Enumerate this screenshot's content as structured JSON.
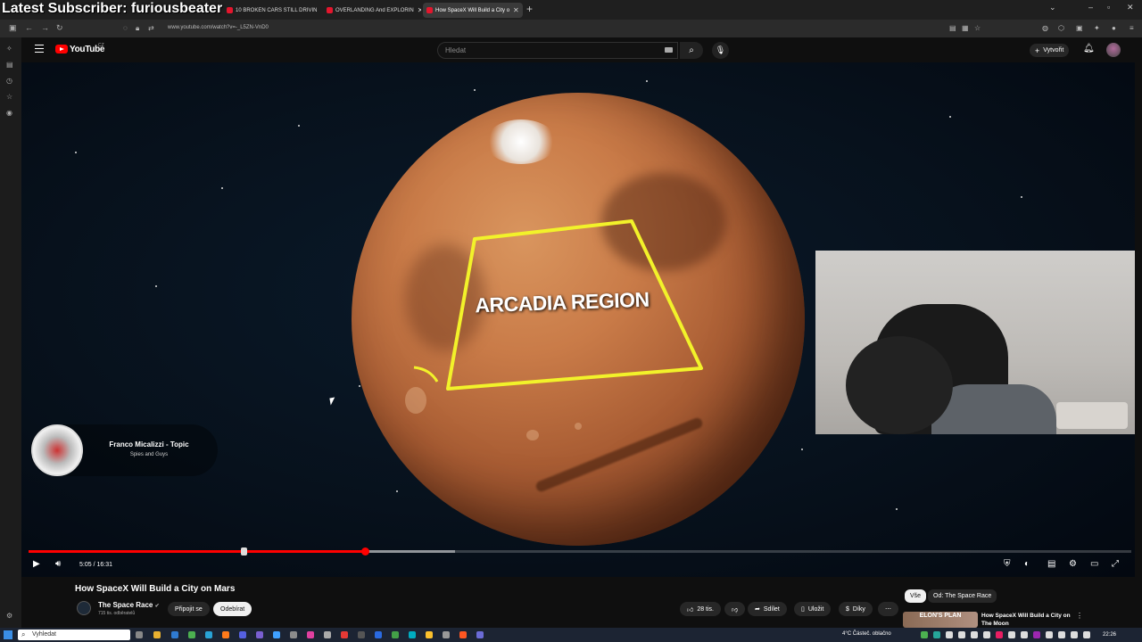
{
  "overlay_text": "Latest Subscriber: furiousbeater",
  "browser": {
    "tabs": [
      {
        "label": "10 BROKEN CARS STILL DRIVIN"
      },
      {
        "label": "OVERLANDING And EXPLORIN"
      },
      {
        "label": "How SpaceX Will Build a City o"
      }
    ],
    "url": "www.youtube.com/watch?v=-_L5ZN-VnD0"
  },
  "youtube": {
    "logo_text": "YouTube",
    "country_code": "CZ",
    "search_placeholder": "Hledat",
    "create_label": "Vytvořit"
  },
  "video": {
    "region_label": "ARCADIA REGION",
    "card": {
      "title": "Franco Micalizzi - Topic",
      "subtitle": "Spies and Guys"
    },
    "time": "5:05 / 16:31",
    "progress_played": 0.305,
    "progress_buffered": 0.387
  },
  "meta": {
    "title": "How SpaceX Will Build a City on Mars",
    "channel": "The Space Race",
    "subscribers": "715 tis. odběratelů",
    "join_label": "Připojit se",
    "subscribe_label": "Odebírat",
    "likes": "28 tis.",
    "share_label": "Sdílet",
    "save_label": "Uložit",
    "thanks_label": "Díky"
  },
  "recommendations": {
    "chips": [
      "Vše",
      "Od: The Space Race"
    ],
    "first": {
      "thumb_text": "ELON'S PLAN",
      "title": "How SpaceX Will Build a City on The Moon"
    }
  },
  "taskbar": {
    "search_placeholder": "Vyhledat",
    "weather": "4°C  Částeč. oblačno",
    "clock": "22:26"
  }
}
